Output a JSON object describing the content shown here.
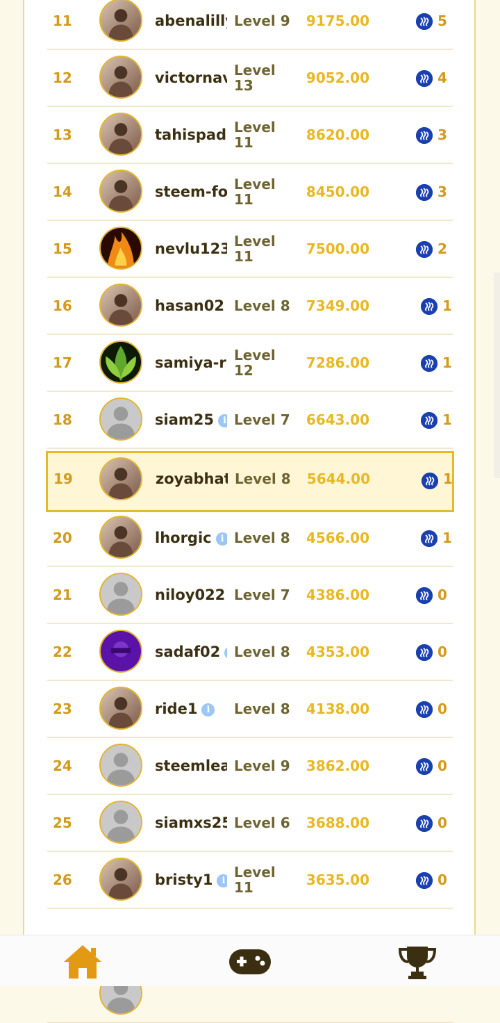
{
  "leaderboard": [
    {
      "rank": "11",
      "username": "abenalilly",
      "level": "Level 9",
      "score": "9175.00",
      "reward": "5",
      "avatar": "photo",
      "info": false
    },
    {
      "rank": "12",
      "username": "victornav",
      "level": "Level 13",
      "score": "9052.00",
      "reward": "4",
      "avatar": "photo",
      "info": false
    },
    {
      "rank": "13",
      "username": "tahispadr",
      "level": "Level 11",
      "score": "8620.00",
      "reward": "3",
      "avatar": "photo",
      "info": false
    },
    {
      "rank": "14",
      "username": "steem-for",
      "level": "Level 11",
      "score": "8450.00",
      "reward": "3",
      "avatar": "photo",
      "info": false
    },
    {
      "rank": "15",
      "username": "nevlu123",
      "level": "Level 11",
      "score": "7500.00",
      "reward": "2",
      "avatar": "fire",
      "info": false
    },
    {
      "rank": "16",
      "username": "hasan02",
      "level": "Level 8",
      "score": "7349.00",
      "reward": "1",
      "avatar": "photo",
      "info": true
    },
    {
      "rank": "17",
      "username": "samiya-ri",
      "level": "Level 12",
      "score": "7286.00",
      "reward": "1",
      "avatar": "leaves",
      "info": false
    },
    {
      "rank": "18",
      "username": "siam25",
      "level": "Level 7",
      "score": "6643.00",
      "reward": "1",
      "avatar": "default",
      "info": true
    },
    {
      "rank": "19",
      "username": "zoyabhat",
      "level": "Level 8",
      "score": "5644.00",
      "reward": "1",
      "avatar": "photo",
      "info": false,
      "highlight": true
    },
    {
      "rank": "20",
      "username": "lhorgic",
      "level": "Level 8",
      "score": "4566.00",
      "reward": "1",
      "avatar": "photo",
      "info": true
    },
    {
      "rank": "21",
      "username": "niloy022",
      "level": "Level 7",
      "score": "4386.00",
      "reward": "0",
      "avatar": "default",
      "info": false
    },
    {
      "rank": "22",
      "username": "sadaf02",
      "level": "Level 8",
      "score": "4353.00",
      "reward": "0",
      "avatar": "purple",
      "info": true
    },
    {
      "rank": "23",
      "username": "ride1",
      "level": "Level 8",
      "score": "4138.00",
      "reward": "0",
      "avatar": "photo",
      "info": true
    },
    {
      "rank": "24",
      "username": "steemlea",
      "level": "Level 9",
      "score": "3862.00",
      "reward": "0",
      "avatar": "default",
      "info": false
    },
    {
      "rank": "25",
      "username": "siamxs25",
      "level": "Level 6",
      "score": "3688.00",
      "reward": "0",
      "avatar": "default",
      "info": false
    },
    {
      "rank": "26",
      "username": "bristy1",
      "level": "Level 11",
      "score": "3635.00",
      "reward": "0",
      "avatar": "photo",
      "info": true
    }
  ],
  "info_glyph": "i",
  "icons": {
    "reward": "steem-coin-icon",
    "info": "info-icon",
    "nav": [
      "home-icon",
      "gamepad-icon",
      "trophy-icon"
    ]
  },
  "colors": {
    "rank": "#d39a1b",
    "score": "#e8b823",
    "username": "#3b2f12",
    "level": "#6e6431",
    "highlight_border": "#e4b92a",
    "highlight_bg": "#fff6d5",
    "steem": "#1a40b0",
    "nav_icon": "#e39a13",
    "gamepad": "#3b2f12"
  }
}
